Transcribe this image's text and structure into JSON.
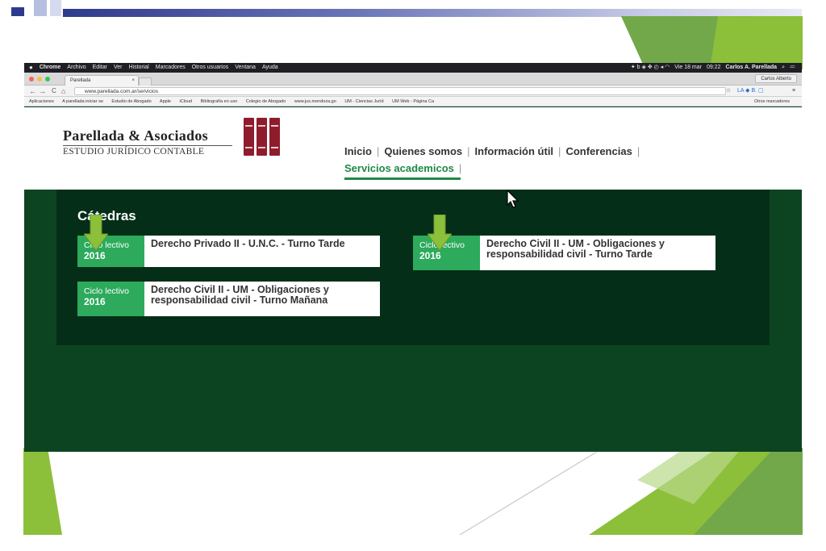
{
  "colors": {
    "slide_accent": "#8cbf3a",
    "site_dark": "#0c4421",
    "site_panel": "#052e18",
    "site_green": "#2daa5c",
    "nav_active": "#1f8a45",
    "logo_red": "#8e1c2c"
  },
  "mac_menu": {
    "apple": "",
    "app": "Chrome",
    "items": [
      "Archivo",
      "Editar",
      "Ver",
      "Historial",
      "Marcadores",
      "Otros usuarios",
      "Ventana",
      "Ayuda"
    ],
    "date": "Vie 18 mar",
    "time": "09:22",
    "user": "Carlos A. Parellada"
  },
  "browser": {
    "tab_title": "Parellada",
    "tab_close": "×",
    "profile": "Carlos Alberto",
    "url": "www.parellada.com.ar/servicios",
    "back": "←",
    "forward": "→",
    "reload": "C",
    "home": "⌂",
    "star": "☆",
    "menu": "≡"
  },
  "bookmarks": [
    "Aplicaciones",
    "A parellada iniciar se",
    "Estudio de Abogado",
    "Apple",
    "iCloud",
    "Bibliografía en uso",
    "Colegio de Abogado",
    "www.jus.mendoza.go",
    "UM - Ciencias Juríd",
    "UM Web - Página Ca"
  ],
  "bookmarks_right": "Otros marcadores",
  "site": {
    "logo_title": "Parellada & Asociados",
    "logo_subtitle": "ESTUDIO JURÍDICO CONTABLE",
    "nav": [
      "Inicio",
      "Quienes somos",
      "Información útil",
      "Conferencias"
    ],
    "nav_active": "Servicios academicos",
    "nav_sep": "|",
    "section_title": "Cátedras",
    "cards": [
      {
        "period_label": "Ciclo lectivo",
        "year": "2016",
        "title": "Derecho Privado II - U.N.C. - Turno Tarde"
      },
      {
        "period_label": "Ciclo lectivo",
        "year": "2016",
        "title": "Derecho Civil II - UM - Obligaciones y responsabilidad civil - Turno Tarde"
      },
      {
        "period_label": "Ciclo lectivo",
        "year": "2016",
        "title": "Derecho Civil II - UM - Obligaciones y responsabilidad civil - Turno Mañana"
      }
    ]
  }
}
